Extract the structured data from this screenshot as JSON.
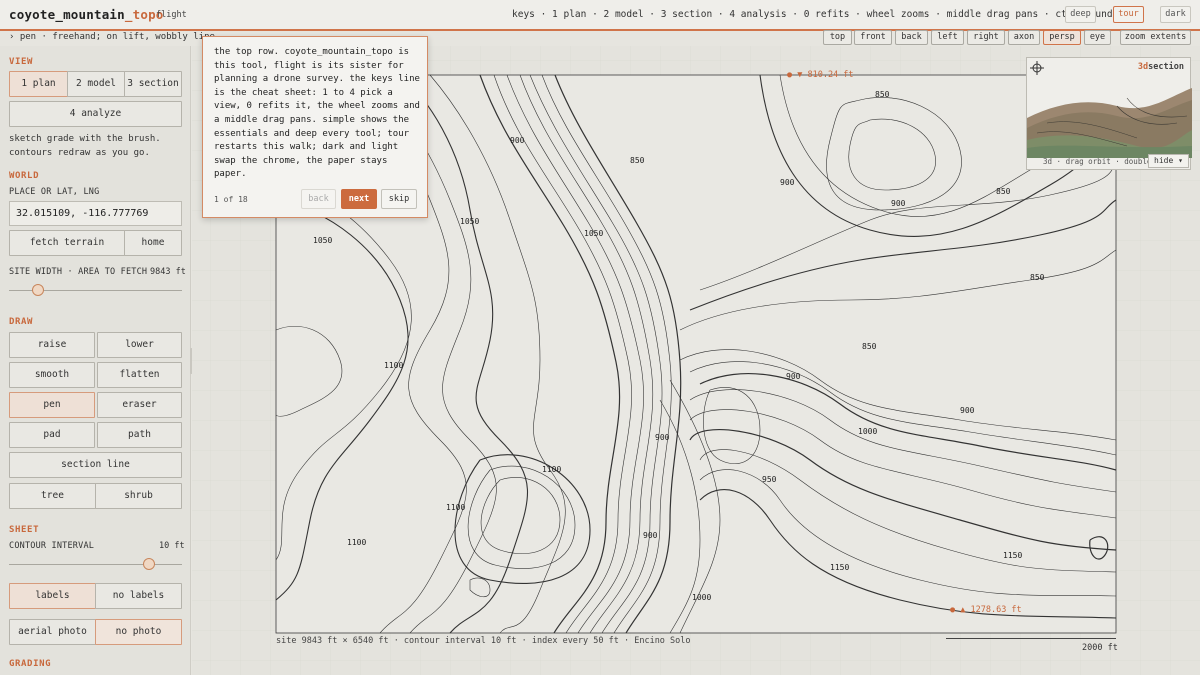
{
  "app": {
    "title_main": "coyote_mountain",
    "title_accent": "_topo",
    "sister_link": "flight",
    "keys_line": "keys · 1 plan · 2 model · 3 section · 4 analysis · 0 refits · wheel zooms · middle drag pans · ctrl+z undo"
  },
  "topbar": {
    "deep": "deep",
    "tour": "tour",
    "dark": "dark"
  },
  "hint": "›  pen · freehand; on lift, wobbly line",
  "view_buttons": [
    "top",
    "front",
    "back",
    "left",
    "right",
    "axon",
    "persp",
    "eye",
    "zoom extents"
  ],
  "active_view": "persp",
  "sidebar": {
    "view": {
      "heading": "VIEW",
      "plan": "1 plan",
      "model": "2 model",
      "section": "3 section",
      "analyze": "4 analyze",
      "note": [
        "sketch grade with the brush.",
        "contours redraw as you go."
      ]
    },
    "world": {
      "heading": "WORLD",
      "place_label": "PLACE OR LAT, LNG",
      "latlng": "32.015109, -116.777769",
      "fetch": "fetch terrain",
      "home": "home",
      "site_width_label": "SITE WIDTH · AREA TO FETCH",
      "site_width_value": "9843 ft",
      "site_width_fraction": 0.17
    },
    "draw": {
      "heading": "DRAW",
      "tools": [
        "raise",
        "lower",
        "smooth",
        "flatten",
        "pen",
        "eraser",
        "pad",
        "path"
      ],
      "active_tool": "pen",
      "section_line": "section line",
      "tree": "tree",
      "shrub": "shrub"
    },
    "sheet": {
      "heading": "SHEET",
      "interval_label": "CONTOUR INTERVAL",
      "interval_value": "10 ft",
      "interval_fraction": 0.81,
      "labels": "labels",
      "no_labels": "no labels",
      "aerial": "aerial photo",
      "no_photo": "no photo"
    },
    "grading": {
      "heading": "GRADING"
    }
  },
  "map": {
    "max_elev": "▼ 810.24 ft",
    "min_elev": "▲ 1278.63 ft",
    "status": "site 9843 ft × 6540 ft · contour interval 10 ft · index every 50 ft · Encino Solo",
    "scale": "2000 ft",
    "contour_labels": [
      "850",
      "900",
      "850",
      "900",
      "850",
      "1050",
      "1050",
      "900",
      "850",
      "1100",
      "1050",
      "850",
      "900",
      "900",
      "1000",
      "900",
      "950",
      "1100",
      "1100",
      "900",
      "1100",
      "1000",
      "1150",
      "1150"
    ]
  },
  "inset": {
    "title_accent": "3d",
    "title_rest": "section",
    "hint": "3d · drag orbit · double-",
    "hide": "hide ▾"
  },
  "tour": {
    "body": "the top row. coyote_mountain_topo is this tool, flight is its sister for planning a drone survey. the keys line is the cheat sheet: 1 to 4 pick a view, 0 refits it, the wheel zooms and a middle drag pans. simple shows the essentials and deep every tool; tour restarts this walk; dark and light swap the chrome, the paper stays paper.",
    "count": "1 of 18",
    "back": "back",
    "next": "next",
    "skip": "skip"
  },
  "colors": {
    "accent": "#c8683c",
    "paper": "#e4e3dd",
    "ink": "#222222"
  }
}
